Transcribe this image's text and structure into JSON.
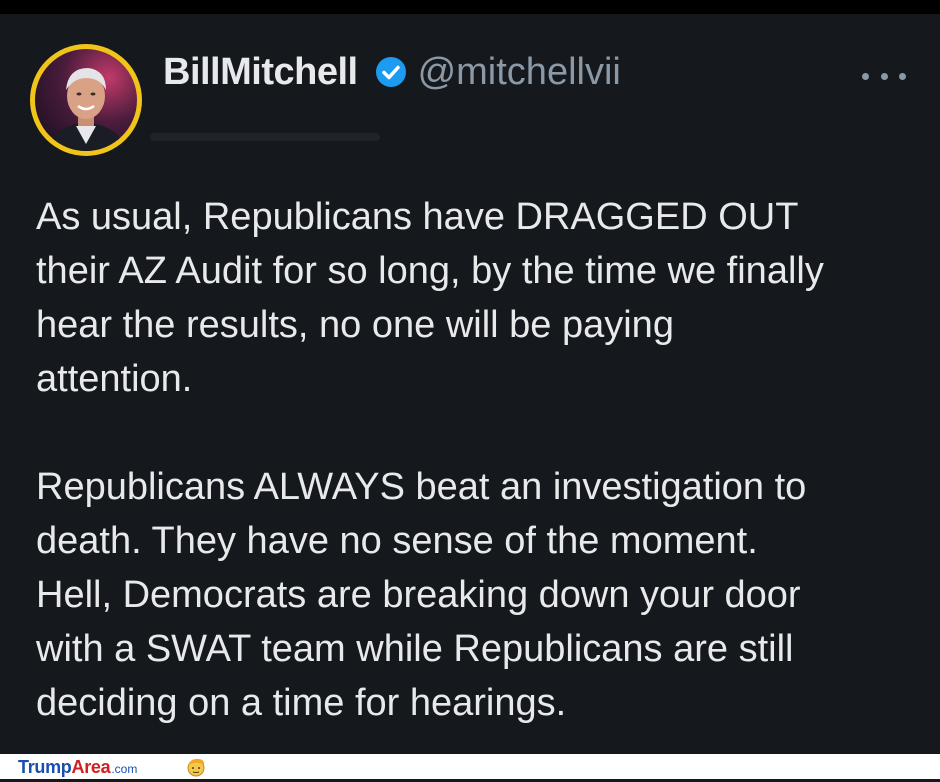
{
  "tweet": {
    "display_name": "BillMitchell",
    "handle": "@mitchellvii",
    "verified_icon": "verified-badge-icon",
    "more_icon": "more-horizontal-icon",
    "paragraphs": [
      "As usual, Republicans have DRAGGED OUT\ntheir AZ Audit for so long, by the time we finally\nhear the results, no one will be paying\nattention.",
      "Republicans ALWAYS beat an investigation to\ndeath. They have no sense of the moment.\nHell, Democrats are breaking down your door\nwith a SWAT team while Republicans are still\ndeciding on a time for hearings."
    ]
  },
  "watermark": {
    "part1": "Trump",
    "part2": "Area",
    "part3": ".com"
  },
  "colors": {
    "background": "#15181d",
    "text": "#e7e9ea",
    "secondary_text": "#8b98a5",
    "verified_blue": "#1d9bf0",
    "avatar_ring": "#f0c419"
  }
}
